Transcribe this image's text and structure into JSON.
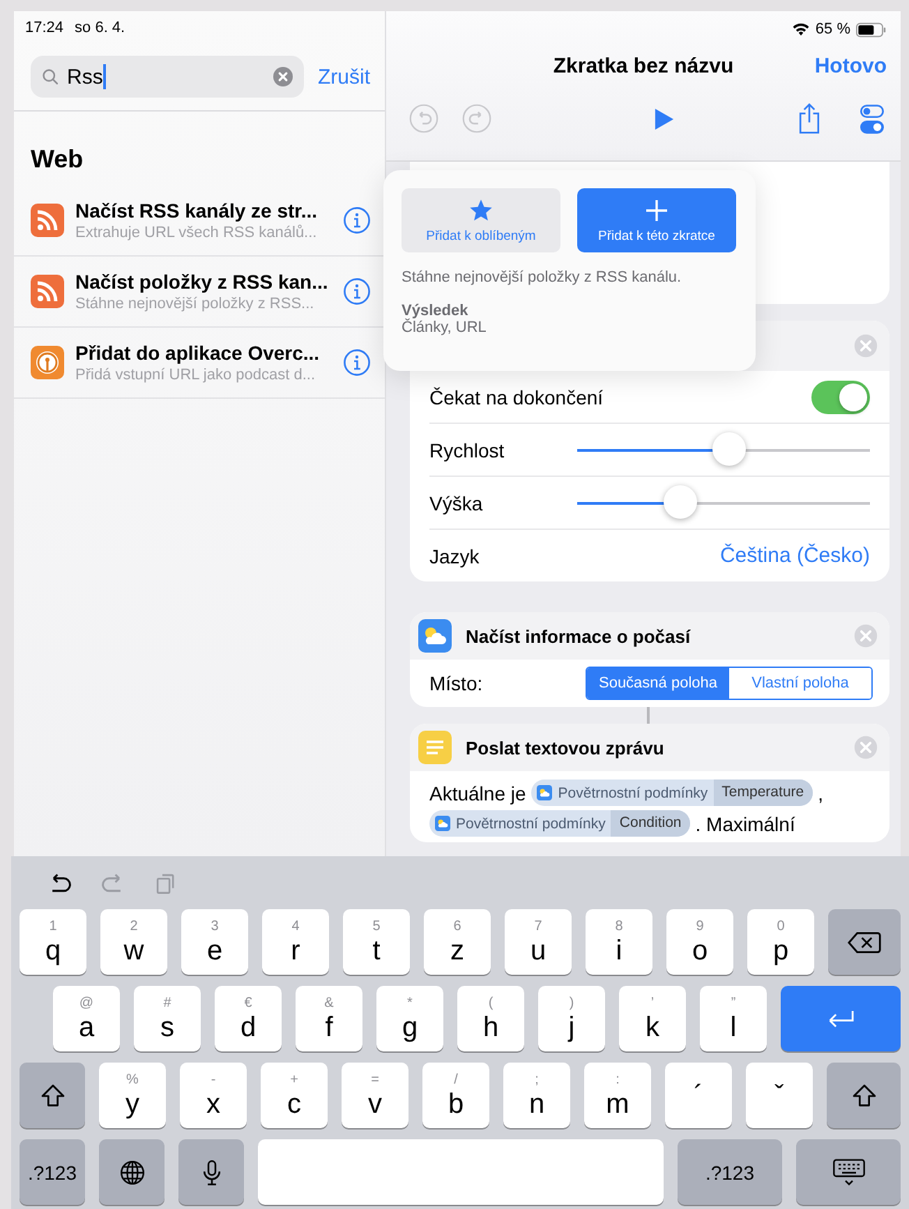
{
  "status_bar": {
    "time": "17:24",
    "date": "so 6. 4.",
    "battery": "65 %"
  },
  "search": {
    "value": "Rss",
    "cancel": "Zrušit"
  },
  "results": {
    "section": "Web",
    "items": [
      {
        "kind": "rss",
        "title": "Načíst RSS kanály ze str...",
        "subtitle": "Extrahuje URL všech RSS kanálů..."
      },
      {
        "kind": "rss",
        "title": "Načíst položky z RSS kan...",
        "subtitle": "Stáhne nejnovější položky z RSS..."
      },
      {
        "kind": "podcast",
        "title": "Přidat do aplikace Overc...",
        "subtitle": "Přidá vstupní URL jako podcast d..."
      }
    ]
  },
  "nav": {
    "title": "Zkratka bez názvu",
    "done": "Hotovo"
  },
  "popover": {
    "favorite": "Přidat k oblíbeným",
    "add": "Přidat k této zkratce",
    "description": "Stáhne nejnovější položky z RSS kanálu.",
    "result_label": "Výsledek",
    "result_value": "Články, URL"
  },
  "speak_card": {
    "rows": [
      {
        "kind": "toggle",
        "label": "Čekat na dokončení",
        "on": true
      },
      {
        "kind": "slider",
        "label": "Rychlost",
        "level": 0.52
      },
      {
        "kind": "slider",
        "label": "Výška",
        "level": 0.35
      },
      {
        "kind": "value",
        "label": "Jazyk",
        "value": "Čeština (Česko)"
      }
    ]
  },
  "weather_card": {
    "title": "Načíst informace o počasí",
    "field_label": "Místo:",
    "options": [
      {
        "label": "Současná poloha",
        "selected": true
      },
      {
        "label": "Vlastní poloha",
        "selected": false
      }
    ]
  },
  "message_card": {
    "title": "Poslat textovou zprávu",
    "body": [
      {
        "kind": "text",
        "text": "Aktuálne je"
      },
      {
        "kind": "token",
        "name": "Povětrnostní podmínky",
        "property": "Temperature"
      },
      {
        "kind": "text",
        "text": ","
      },
      {
        "kind": "token",
        "name": "Povětrnostní podmínky",
        "property": "Condition"
      },
      {
        "kind": "text",
        "text": ". Maximální"
      }
    ]
  },
  "keyboard": {
    "rows": [
      [
        {
          "kind": "letter",
          "label": "q",
          "hint": "1"
        },
        {
          "kind": "letter",
          "label": "w",
          "hint": "2"
        },
        {
          "kind": "letter",
          "label": "e",
          "hint": "3"
        },
        {
          "kind": "letter",
          "label": "r",
          "hint": "4"
        },
        {
          "kind": "letter",
          "label": "t",
          "hint": "5"
        },
        {
          "kind": "letter",
          "label": "z",
          "hint": "6"
        },
        {
          "kind": "letter",
          "label": "u",
          "hint": "7"
        },
        {
          "kind": "letter",
          "label": "i",
          "hint": "8"
        },
        {
          "kind": "letter",
          "label": "o",
          "hint": "9"
        },
        {
          "kind": "letter",
          "label": "p",
          "hint": "0"
        },
        {
          "kind": "backspace"
        }
      ],
      [
        {
          "kind": "letter",
          "label": "a",
          "hint": "@"
        },
        {
          "kind": "letter",
          "label": "s",
          "hint": "#"
        },
        {
          "kind": "letter",
          "label": "d",
          "hint": "€"
        },
        {
          "kind": "letter",
          "label": "f",
          "hint": "&"
        },
        {
          "kind": "letter",
          "label": "g",
          "hint": "*"
        },
        {
          "kind": "letter",
          "label": "h",
          "hint": "("
        },
        {
          "kind": "letter",
          "label": "j",
          "hint": ")"
        },
        {
          "kind": "letter",
          "label": "k",
          "hint": "’"
        },
        {
          "kind": "letter",
          "label": "l",
          "hint": "”"
        },
        {
          "kind": "return"
        }
      ],
      [
        {
          "kind": "shift"
        },
        {
          "kind": "letter",
          "label": "y",
          "hint": "%"
        },
        {
          "kind": "letter",
          "label": "x",
          "hint": "-"
        },
        {
          "kind": "letter",
          "label": "c",
          "hint": "+"
        },
        {
          "kind": "letter",
          "label": "v",
          "hint": "="
        },
        {
          "kind": "letter",
          "label": "b",
          "hint": "/"
        },
        {
          "kind": "letter",
          "label": "n",
          "hint": ";"
        },
        {
          "kind": "letter",
          "label": "m",
          "hint": ":"
        },
        {
          "kind": "letter",
          "label": "´"
        },
        {
          "kind": "letter",
          "label": "ˇ"
        },
        {
          "kind": "shift"
        }
      ],
      [
        {
          "kind": "mode",
          "label": ".?123"
        },
        {
          "kind": "globe"
        },
        {
          "kind": "mic"
        },
        {
          "kind": "space"
        },
        {
          "kind": "mode",
          "label": ".?123"
        },
        {
          "kind": "hide"
        }
      ]
    ]
  }
}
